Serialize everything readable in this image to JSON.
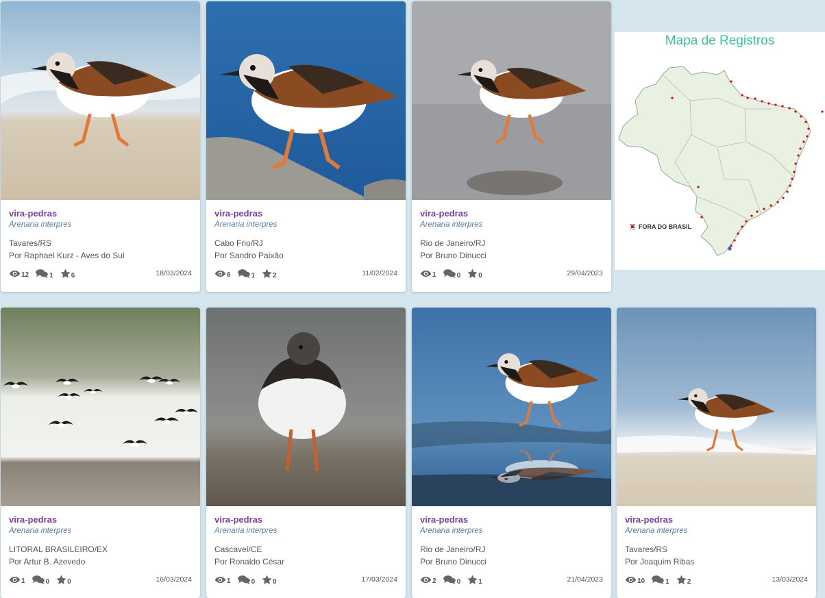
{
  "map": {
    "title": "Mapa de Registros",
    "legend": "FORA DO BRASIL",
    "point_color": "#e00000"
  },
  "cards": [
    {
      "common": "vira-pedras",
      "scientific": "Arenaria interpres",
      "location": "Tavares/RS",
      "author": "Por Raphael Kurz - Aves do Sul",
      "views": "12",
      "comments": "1",
      "stars": "6",
      "date": "18/03/2024"
    },
    {
      "common": "vira-pedras",
      "scientific": "Arenaria interpres",
      "location": "Cabo Frio/RJ",
      "author": "Por Sandro Paixão",
      "views": "6",
      "comments": "1",
      "stars": "2",
      "date": "11/02/2024"
    },
    {
      "common": "vira-pedras",
      "scientific": "Arenaria interpres",
      "location": "Rio de Janeiro/RJ",
      "author": "Por Bruno Dinucci",
      "views": "1",
      "comments": "0",
      "stars": "0",
      "date": "29/04/2023"
    },
    {
      "common": "vira-pedras",
      "scientific": "Arenaria interpres",
      "location": "LITORAL BRASILEIRO/EX",
      "author": "Por Artur B. Azevedo",
      "views": "1",
      "comments": "0",
      "stars": "0",
      "date": "16/03/2024"
    },
    {
      "common": "vira-pedras",
      "scientific": "Arenaria interpres",
      "location": "Cascavel/CE",
      "author": "Por Ronaldo César",
      "views": "1",
      "comments": "0",
      "stars": "0",
      "date": "17/03/2024"
    },
    {
      "common": "vira-pedras",
      "scientific": "Arenaria interpres",
      "location": "Rio de Janeiro/RJ",
      "author": "Por Bruno Dinucci",
      "views": "2",
      "comments": "0",
      "stars": "1",
      "date": "21/04/2023"
    },
    {
      "common": "vira-pedras",
      "scientific": "Arenaria interpres",
      "location": "Tavares/RS",
      "author": "Por Joaquim Ribas",
      "views": "10",
      "comments": "1",
      "stars": "2",
      "date": "13/03/2024"
    }
  ]
}
